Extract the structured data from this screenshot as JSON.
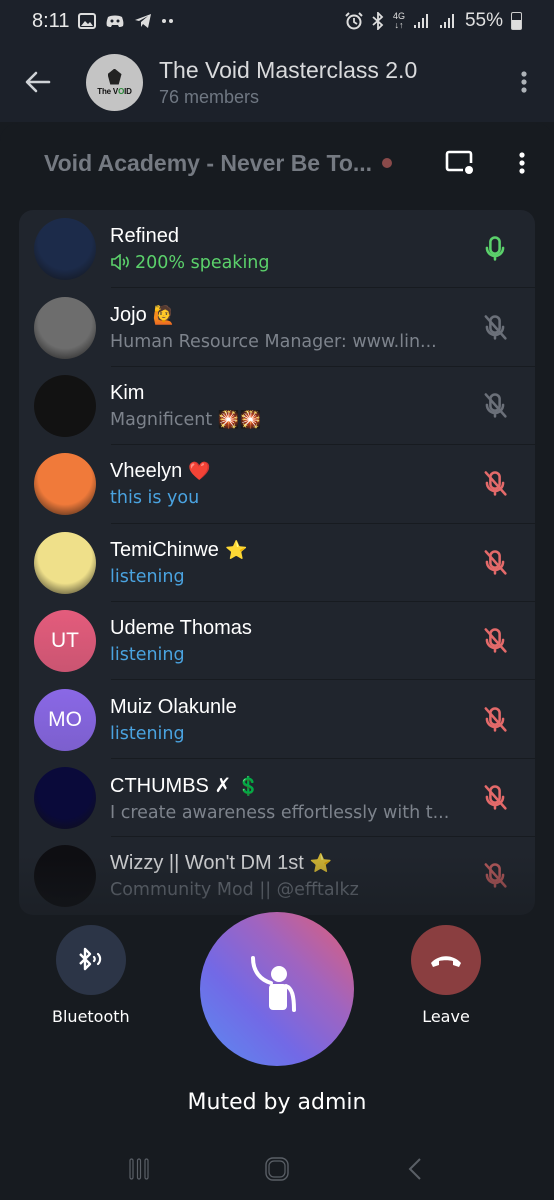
{
  "status_bar": {
    "time": "8:11",
    "network": "4G",
    "battery": "55%",
    "icons": [
      "gallery-icon",
      "discord-icon",
      "telegram-icon",
      "more-notifications-icon",
      "alarm-icon",
      "bluetooth-icon",
      "network-4g-icon",
      "signal-icon",
      "signal-icon",
      "battery-icon"
    ]
  },
  "header": {
    "title": "The Void Masterclass 2.0",
    "subtitle": "76 members",
    "avatar_text": "The V",
    "avatar_text_accent": "O",
    "avatar_text_end": "ID"
  },
  "voice_chat": {
    "title": "Void Academy - Never Be To...",
    "recording_dot_color": "#8a4a4a"
  },
  "colors": {
    "speaking": "#5bd16b",
    "listening": "#4aa3e0",
    "muted_by_admin": "#e46a6a",
    "muted_self": "#6b7079",
    "about": "#7d838c"
  },
  "participants": [
    {
      "name": "Refined",
      "badge": "",
      "status": "200% speaking",
      "status_type": "speaking",
      "mic": "active",
      "avatar": "image",
      "avatar_bg": "#1c2b4a"
    },
    {
      "name": "Jojo",
      "badge": "🙋",
      "status": "Human Resource Manager: www.lin...",
      "status_type": "about",
      "mic": "muted-self",
      "avatar": "image",
      "avatar_bg": "#6d6d6d"
    },
    {
      "name": "Kim",
      "badge": "",
      "status": "Magnificent 🎇🎇",
      "status_type": "about",
      "mic": "muted-self",
      "avatar": "image",
      "avatar_bg": "#121212"
    },
    {
      "name": "Vheelyn",
      "badge": "❤️",
      "status": "this is you",
      "status_type": "listening",
      "mic": "muted-admin",
      "avatar": "image",
      "avatar_bg": "#f07a3a"
    },
    {
      "name": "TemiChinwe",
      "badge": "⭐",
      "status": "listening",
      "status_type": "listening",
      "mic": "muted-admin",
      "avatar": "image",
      "avatar_bg": "#efe08a"
    },
    {
      "name": "Udeme Thomas",
      "badge": "",
      "status": "listening",
      "status_type": "listening",
      "mic": "muted-admin",
      "avatar": "initials",
      "initials": "UT",
      "avatar_bg": "#e45c7c"
    },
    {
      "name": "Muiz Olakunle",
      "badge": "",
      "status": "listening",
      "status_type": "listening",
      "mic": "muted-admin",
      "avatar": "initials",
      "initials": "MO",
      "avatar_bg": "#8a68e6"
    },
    {
      "name": "CTHUMBS ✗",
      "badge": "💲",
      "status": "I create awareness effortlessly with t...",
      "status_type": "about",
      "mic": "muted-admin",
      "avatar": "image",
      "avatar_bg": "#0a0a3a"
    },
    {
      "name": "Wizzy || Won't DM 1st",
      "badge": "⭐",
      "status": "Community Mod || @efftalkz",
      "status_type": "about",
      "mic": "muted-admin",
      "avatar": "image",
      "avatar_bg": "#0e0e12"
    }
  ],
  "controls": {
    "bluetooth_label": "Bluetooth",
    "leave_label": "Leave",
    "raise_hand_state": "Muted by admin"
  },
  "navbar": {
    "recents": "recents-icon",
    "home": "home-icon",
    "back": "back-icon"
  }
}
